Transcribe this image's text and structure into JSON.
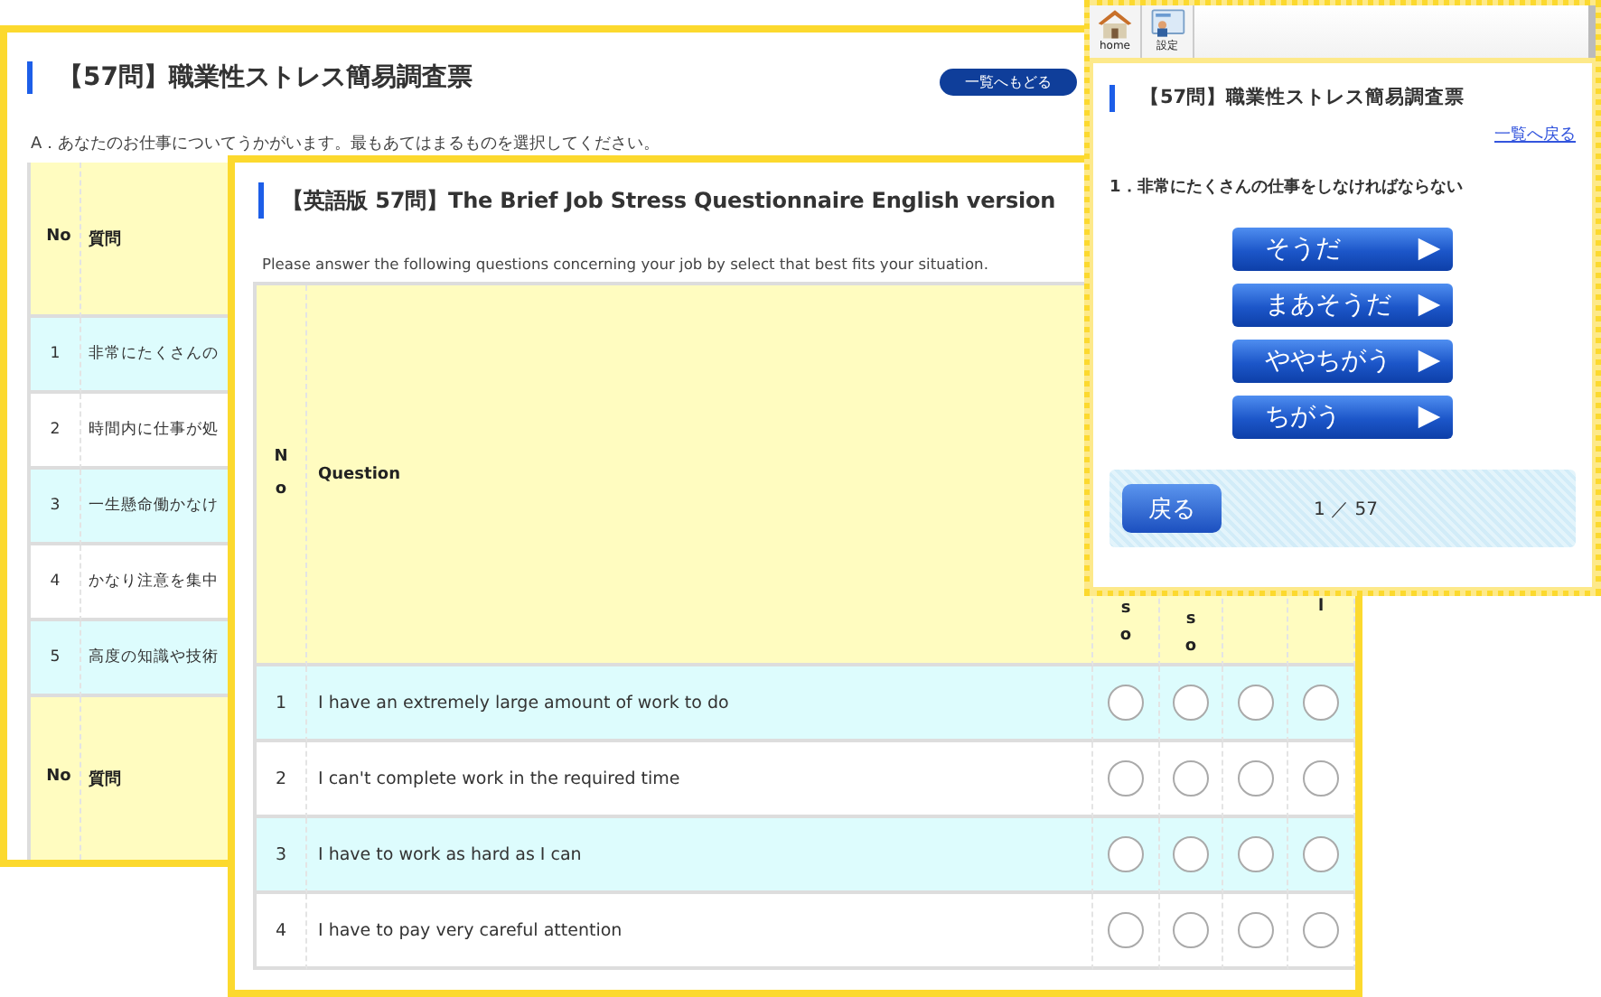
{
  "japanese_page": {
    "title": "【57問】職業性ストレス簡易調査票",
    "back_button": "一覧へもどる",
    "instruction": "A．あなたのお仕事についてうかがいます。最もあてはまるものを選択してください。",
    "table": {
      "columns": [
        "No",
        "質問"
      ],
      "rows": [
        {
          "no": "1",
          "question": "非常にたくさんの"
        },
        {
          "no": "2",
          "question": "時間内に仕事が処"
        },
        {
          "no": "3",
          "question": "一生懸命働かなけ"
        },
        {
          "no": "4",
          "question": "かなり注意を集中"
        },
        {
          "no": "5",
          "question": "高度の知識や技術"
        }
      ],
      "repeated_header": [
        "No",
        "質問"
      ]
    }
  },
  "english_page": {
    "title": "【英語版 57問】The Brief Job Stress Questionnaire English version",
    "instruction": "Please answer the following questions concerning your job by select that best fits your situation.",
    "table": {
      "columns": [
        "No",
        "Question"
      ],
      "answer_columns": [
        {
          "label": "so"
        },
        {
          "label": "so"
        },
        {},
        {
          "label": "l"
        }
      ],
      "rows": [
        {
          "no": "1",
          "question": "I have an extremely large amount of work to do",
          "options": [
            {
              "selected": false
            },
            {
              "selected": false
            },
            {
              "selected": false
            },
            {
              "selected": false
            }
          ]
        },
        {
          "no": "2",
          "question": "I can't complete work in the required time",
          "options": [
            {
              "selected": false
            },
            {
              "selected": false
            },
            {
              "selected": false
            },
            {
              "selected": false
            }
          ]
        },
        {
          "no": "3",
          "question": "I have to work as hard as I can",
          "options": [
            {
              "selected": false
            },
            {
              "selected": false
            },
            {
              "selected": false
            },
            {
              "selected": false
            }
          ]
        },
        {
          "no": "4",
          "question": "I have to pay very careful attention",
          "options": [
            {
              "selected": false
            },
            {
              "selected": false
            },
            {
              "selected": false
            },
            {
              "selected": false
            }
          ]
        }
      ]
    }
  },
  "mobile_page": {
    "toolbar": [
      {
        "kind": "home",
        "label": "home"
      },
      {
        "kind": "settings",
        "label": "設定"
      }
    ],
    "title": "【57問】職業性ストレス簡易調査票",
    "list_link": "一覧へ戻る",
    "question": "1．非常にたくさんの仕事をしなければならない",
    "answers": [
      "そうだ",
      "まあそうだ",
      "ややちがう",
      "ちがう"
    ],
    "back_button": "戻る",
    "progress": "1 ／ 57"
  }
}
